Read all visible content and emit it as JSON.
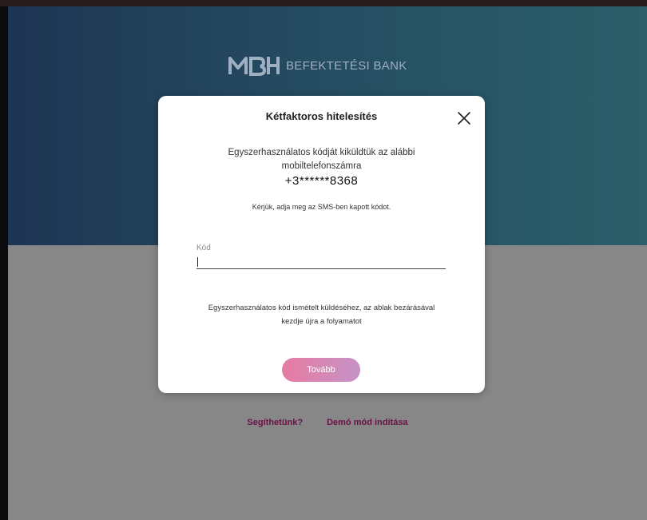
{
  "header": {
    "brand_text": "BEFEKTETÉSI BANK",
    "logo_icon": "mbh-logo-icon"
  },
  "modal": {
    "title": "Kétfaktoros hitelesítés",
    "close_icon": "close-icon",
    "message": "Egyszerhasználatos kódját kiküldtük az alábbi mobiltelefonszámra",
    "phone_number": "+3******8368",
    "hint": "Kérjük, adja meg az SMS-ben kapott kódot.",
    "code_field": {
      "label": "Kód",
      "value": ""
    },
    "resend_note": "Egyszerhasználatos kód ismételt küldéséhez, az ablak bezárásával kezdje újra a folyamatot",
    "next_button": "Tovább"
  },
  "footer": {
    "help_link": "Segíthetünk?",
    "demo_link": "Demó mód indítása"
  },
  "colors": {
    "accent_pink": "#e77ba2",
    "link_color": "#6b1145",
    "hero_start": "#1d3553",
    "hero_end": "#2b5f6a"
  }
}
